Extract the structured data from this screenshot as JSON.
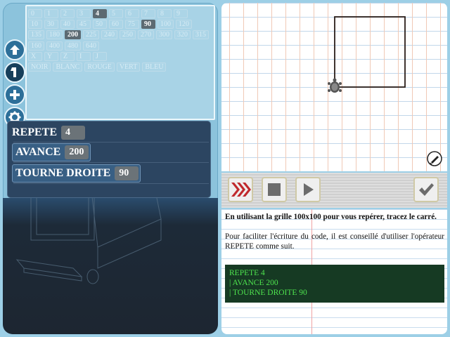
{
  "palette": {
    "rows": [
      [
        "0",
        "1",
        "2",
        "3",
        "4",
        "5",
        "6",
        "7",
        "8",
        "9"
      ],
      [
        "10",
        "30",
        "40",
        "45",
        "50",
        "60",
        "75",
        "90",
        "100",
        "120"
      ],
      [
        "135",
        "180",
        "200",
        "225",
        "240",
        "250",
        "270",
        "300",
        "320",
        "315"
      ],
      [
        "160",
        "400",
        "480",
        "640"
      ],
      [
        "X",
        "Y",
        "Z",
        "I",
        "J"
      ],
      [
        "NOIR",
        "BLANC",
        "ROUGE",
        "VERT",
        "BLEU"
      ]
    ],
    "selected": [
      "4",
      "90",
      "200"
    ]
  },
  "side_buttons": [
    "up-arrow-icon",
    "step-icon",
    "plus-icon",
    "gear-icon"
  ],
  "program": {
    "repeat_label": "REPETE",
    "repeat_value": "4",
    "forward_label": "AVANCE",
    "forward_value": "200",
    "turn_label": "TOURNE DROITE",
    "turn_value": "90"
  },
  "toolbar": {
    "buttons": [
      "fast-forward-icon",
      "stop-icon",
      "play-icon",
      "check-icon"
    ]
  },
  "instructions": {
    "task": "En utilisant la grille 100x100 pour vous repérer, tracez le carré.",
    "hint": "Pour faciliter l'écriture du code, il est conseillé d'utiliser l'opérateur REPETE comme suit.",
    "code_example": {
      "line1": "REPETE 4",
      "line2": "| AVANCE 200",
      "line3": "| TOURNE DROITE 90"
    }
  },
  "colors": {
    "accent_red": "#c0292d",
    "code_bg": "#163a23",
    "code_fg": "#4ee34e",
    "panel_blue": "#8cc3dc"
  }
}
